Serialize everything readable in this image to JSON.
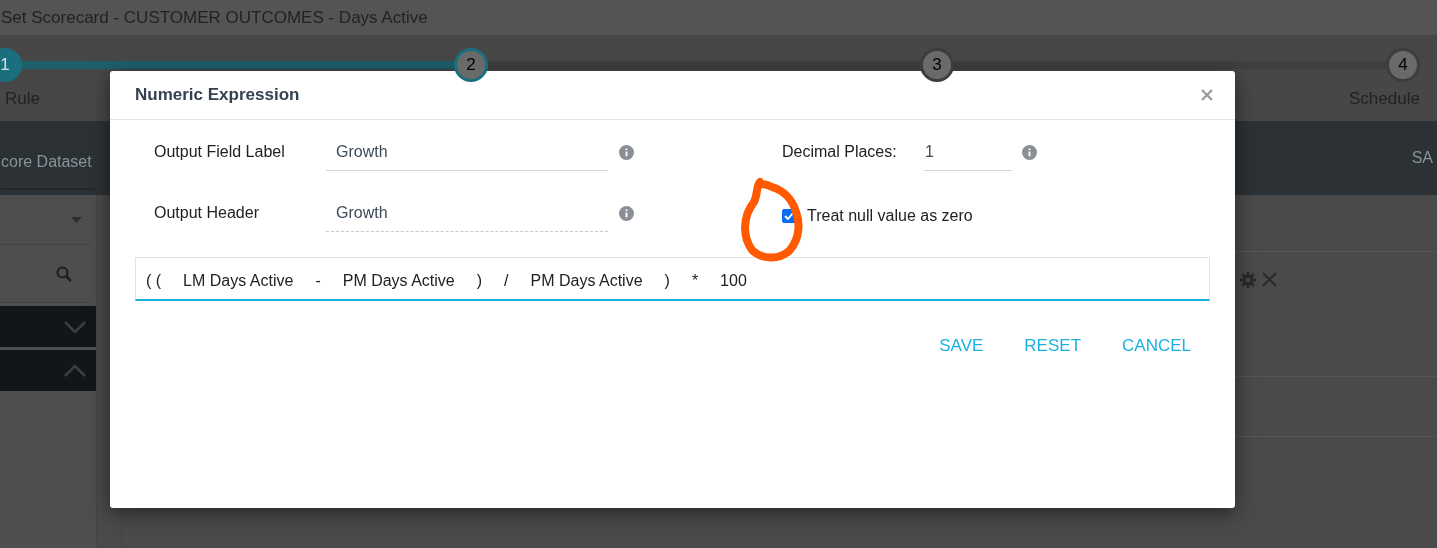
{
  "page_title": "Set Scorecard - CUSTOMER OUTCOMES - Days Active",
  "stepper": [
    {
      "number": "1",
      "label": "Rule",
      "kind": "done"
    },
    {
      "number": "2",
      "kind": "current"
    },
    {
      "number": "3",
      "kind": "todo"
    },
    {
      "number": "4",
      "label": "Schedule",
      "kind": "todo"
    }
  ],
  "toolbar": {
    "tab": "core Dataset",
    "action": "SA"
  },
  "sidebar": {
    "sections": [
      {
        "expanded": false
      },
      {
        "expanded": true
      }
    ]
  },
  "dialog": {
    "title": "Numeric Expression",
    "fields": [
      {
        "label": "Output Field Label",
        "value": "Growth",
        "kind": "solid"
      },
      {
        "label": "Output Header",
        "value": "Growth",
        "kind": "dashed"
      }
    ],
    "decimal": {
      "label": "Decimal Places:",
      "value": "1"
    },
    "checkbox": {
      "label": "Treat null value as zero",
      "checked": true
    },
    "expression": [
      "( (",
      "LM Days Active",
      "-",
      "PM Days Active",
      ")",
      "/",
      "PM Days Active",
      ")",
      "*",
      "100"
    ],
    "buttons": [
      "SAVE",
      "RESET",
      "CANCEL"
    ]
  }
}
